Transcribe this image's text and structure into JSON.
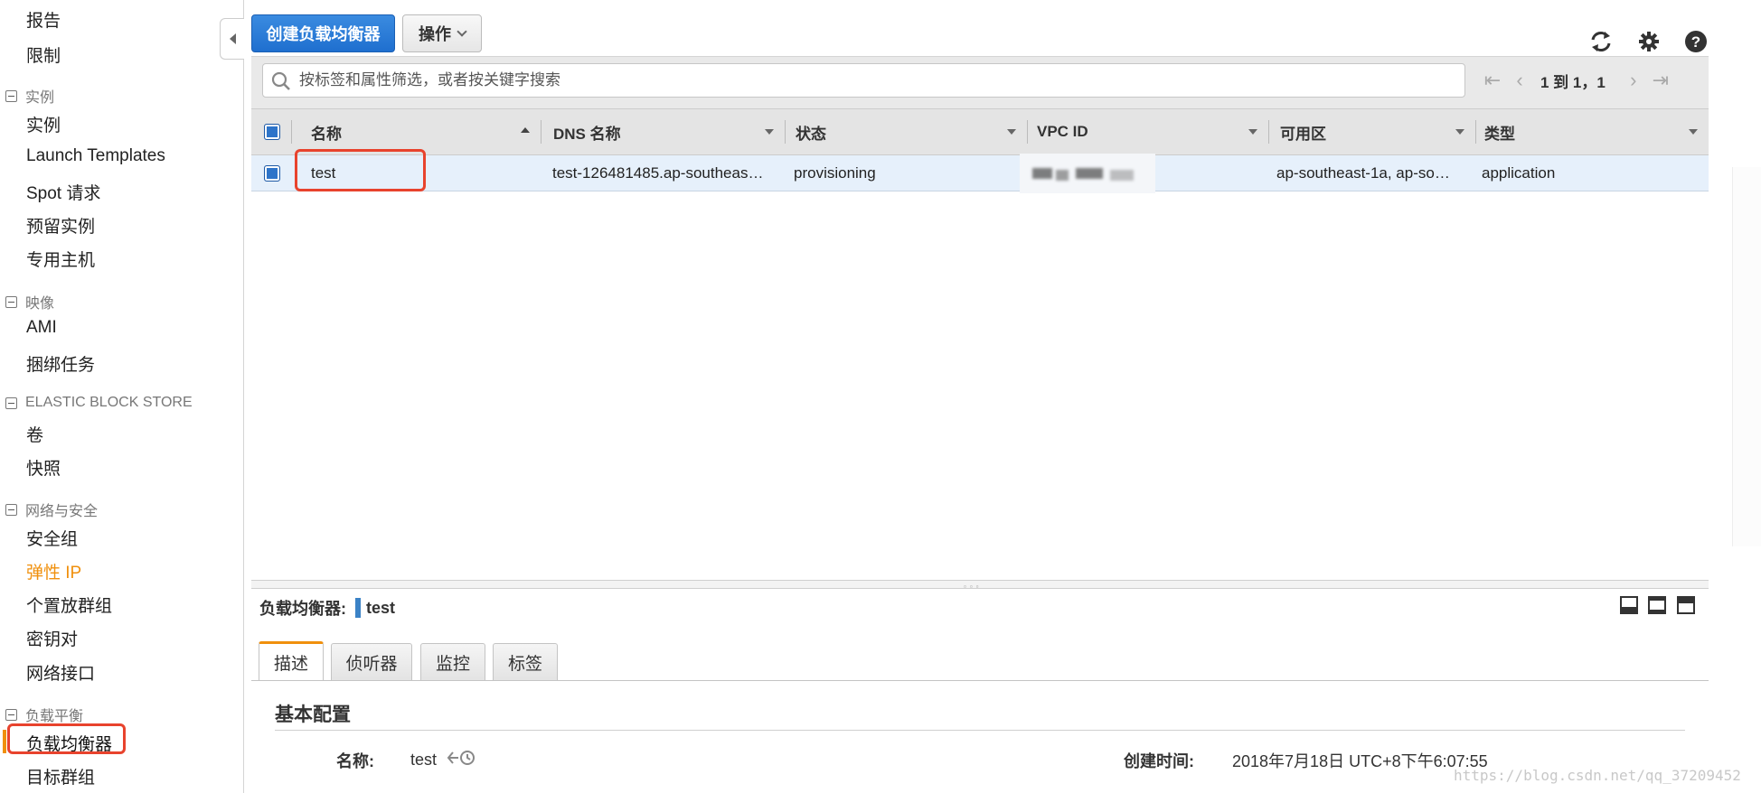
{
  "sidebar": {
    "items": [
      {
        "label": "报告",
        "type": "item"
      },
      {
        "label": "限制",
        "type": "item"
      },
      {
        "label": "实例",
        "type": "group"
      },
      {
        "label": "实例",
        "type": "item"
      },
      {
        "label": "Launch Templates",
        "type": "item"
      },
      {
        "label": "Spot 请求",
        "type": "item"
      },
      {
        "label": "预留实例",
        "type": "item"
      },
      {
        "label": "专用主机",
        "type": "item"
      },
      {
        "label": "映像",
        "type": "group"
      },
      {
        "label": "AMI",
        "type": "item"
      },
      {
        "label": "捆绑任务",
        "type": "item"
      },
      {
        "label": "ELASTIC BLOCK STORE",
        "type": "group"
      },
      {
        "label": "卷",
        "type": "item"
      },
      {
        "label": "快照",
        "type": "item"
      },
      {
        "label": "网络与安全",
        "type": "group"
      },
      {
        "label": "安全组",
        "type": "item"
      },
      {
        "label": "弹性 IP",
        "type": "item"
      },
      {
        "label": "个置放群组",
        "type": "item"
      },
      {
        "label": "密钥对",
        "type": "item"
      },
      {
        "label": "网络接口",
        "type": "item"
      },
      {
        "label": "负载平衡",
        "type": "group"
      },
      {
        "label": "负载均衡器",
        "type": "item",
        "selected": true
      },
      {
        "label": "目标群组",
        "type": "item"
      }
    ]
  },
  "toolbar": {
    "create_label": "创建负载均衡器",
    "actions_label": "操作",
    "icons": [
      "refresh-icon",
      "gear-icon",
      "help-icon"
    ]
  },
  "filter": {
    "placeholder": "按标签和属性筛选，或者按关键字搜索",
    "pager_text": "1 到 1，1"
  },
  "table": {
    "columns": [
      "名称",
      "DNS 名称",
      "状态",
      "VPC ID",
      "可用区",
      "类型"
    ],
    "rows": [
      {
        "name": "test",
        "dns": "test-126481485.ap-southeas…",
        "state": "provisioning",
        "vpc": "",
        "az": "ap-southeast-1a, ap-so…",
        "type": "application"
      }
    ]
  },
  "details": {
    "title_prefix": "负载均衡器:",
    "title_name": "test",
    "tabs": [
      "描述",
      "侦听器",
      "监控",
      "标签"
    ],
    "active_tab": "描述",
    "section_title": "基本配置",
    "name_label": "名称:",
    "name_value": "test",
    "created_label": "创建时间:",
    "created_value": "2018年7月18日 UTC+8下午6:07:55"
  },
  "watermark": "https://blog.csdn.net/qq_37209452",
  "colors": {
    "accent": "#f0900d",
    "primary_button": "#2a7dd6",
    "highlight_box": "#e8432d",
    "selected_row": "#e6f0fb"
  }
}
